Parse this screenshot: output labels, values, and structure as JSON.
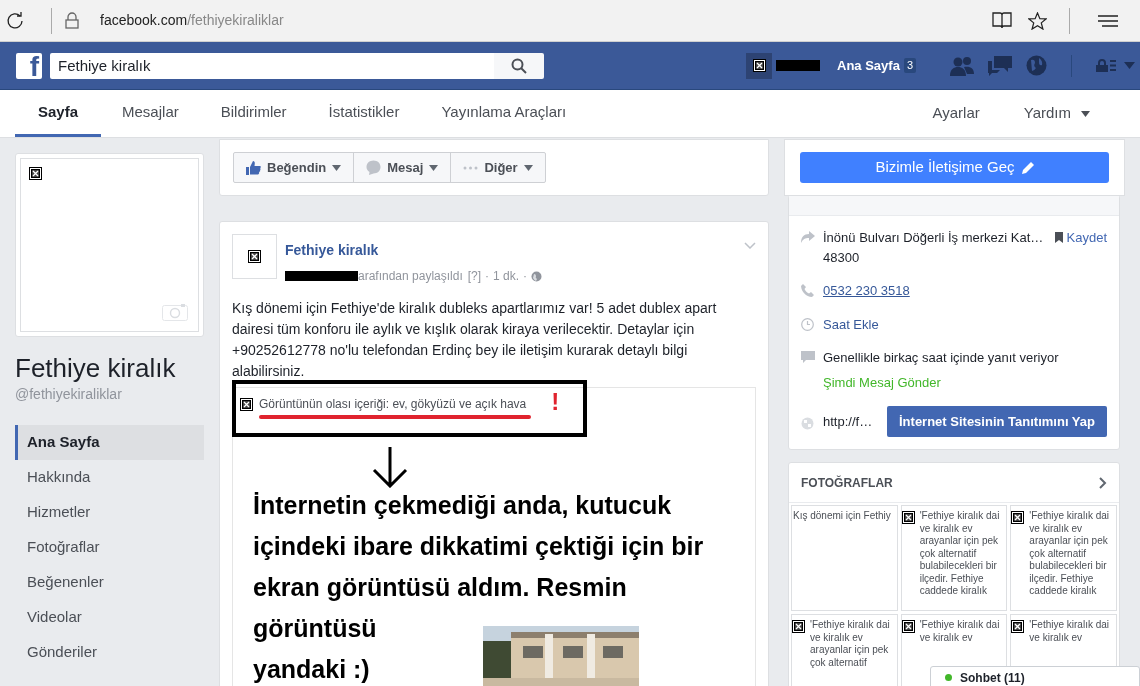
{
  "browser": {
    "url_domain": "facebook.com",
    "url_path": "/fethiyekiraliklar"
  },
  "topbar": {
    "logo": "f",
    "search": {
      "value": "Fethiye kiralık"
    },
    "home": "Ana Sayfa",
    "home_badge": "3"
  },
  "tabs": [
    {
      "label": "Sayfa",
      "selected": true
    },
    {
      "label": "Mesajlar",
      "selected": false
    },
    {
      "label": "Bildirimler",
      "selected": false
    },
    {
      "label": "İstatistikler",
      "selected": false
    },
    {
      "label": "Yayınlama Araçları",
      "selected": false
    }
  ],
  "tabs_right": [
    {
      "label": "Ayarlar",
      "kind": "link"
    },
    {
      "label": "Yardım",
      "kind": "menu"
    }
  ],
  "page": {
    "name": "Fethiye kiralık",
    "handle": "@fethiyekiraliklar"
  },
  "nav": [
    {
      "label": "Ana Sayfa",
      "selected": true
    },
    {
      "label": "Hakkında",
      "selected": false
    },
    {
      "label": "Hizmetler",
      "selected": false
    },
    {
      "label": "Fotoğraflar",
      "selected": false
    },
    {
      "label": "Beğenenler",
      "selected": false
    },
    {
      "label": "Videolar",
      "selected": false
    },
    {
      "label": "Gönderiler",
      "selected": false
    }
  ],
  "actions": [
    {
      "label": "Beğendin",
      "kind": "like"
    },
    {
      "label": "Mesaj",
      "kind": "message"
    },
    {
      "label": "Diğer",
      "kind": "more"
    }
  ],
  "post": {
    "author": "Fethiye kiralık",
    "meta": [
      {
        "kind": "text",
        "text": "arafından paylaşıldı"
      },
      {
        "kind": "help",
        "text": "[?]"
      },
      {
        "kind": "sep",
        "text": "·"
      },
      {
        "kind": "text",
        "text": "1 dk."
      },
      {
        "kind": "sep",
        "text": "·"
      }
    ],
    "text": "Kış dönemi için Fethiye'de kiralık dubleks apartlarımız var! 5 adet dublex apart dairesi tüm konforu ile aylık ve kışlık olarak kiraya verilecektir. Detaylar için +90252612778 no'lu telefondan Erdinç bey ile iletişim kurarak detaylı bilgi alabilirsiniz.",
    "image_alt": "Görüntünün olası içeriği: ev, gökyüzü ve açık hava"
  },
  "annotation": {
    "mark": "!",
    "text": "İnternetin çekmediği anda, kutucuk içindeki ibare dikkatimi çektiği için bir ekran görüntüsü aldım. Resmin",
    "text_end": "görüntüsü yandaki :)"
  },
  "contact_button": "Bizimle İletişime Geç",
  "about": [
    {
      "kind": "address",
      "text": "İnönü Bulvarı Döğerli İş merkezi Kat…",
      "line2": "48300",
      "action": "Kaydet"
    },
    {
      "kind": "phone",
      "text": "0532 230 3518"
    },
    {
      "kind": "hours",
      "text": "Saat Ekle"
    },
    {
      "kind": "response",
      "text": "Genellikle birkaç saat içinde yanıt veriyor",
      "action": "Şimdi Mesaj Gönder"
    },
    {
      "kind": "website",
      "text": "http://f…",
      "action": "İnternet Sitesinin Tanıtımını Yap"
    }
  ],
  "photos": {
    "title": "FOTOĞRAFLAR",
    "tiles": [
      {
        "kind": "clipped",
        "lines": [
          "Kış dönemi için Fethiy"
        ]
      },
      {
        "kind": "alt",
        "lines": [
          "'Fethiye kiralık dai",
          "ve kiralık ev",
          "arayanlar için pek",
          "çok alternatif",
          "bulabilecekleri bir",
          "ilçedir. Fethiye",
          "caddede kiralık"
        ]
      },
      {
        "kind": "alt",
        "lines": [
          "'Fethiye kiralık dai",
          "ve kiralık ev",
          "arayanlar için pek",
          "çok alternatif",
          "bulabilecekleri bir",
          "ilçedir. Fethiye",
          "caddede kiralık"
        ]
      },
      {
        "kind": "alt",
        "lines": [
          "'Fethiye kiralık dai",
          "ve kiralık ev",
          "arayanlar için pek",
          "çok alternatif"
        ]
      },
      {
        "kind": "alt",
        "lines": [
          "'Fethiye kiralık dai",
          "ve kiralık ev"
        ]
      },
      {
        "kind": "alt",
        "lines": [
          "'Fethiye kiralık dai",
          "ve kiralık ev"
        ]
      }
    ]
  },
  "chat": {
    "label": "Sohbet (11)"
  }
}
